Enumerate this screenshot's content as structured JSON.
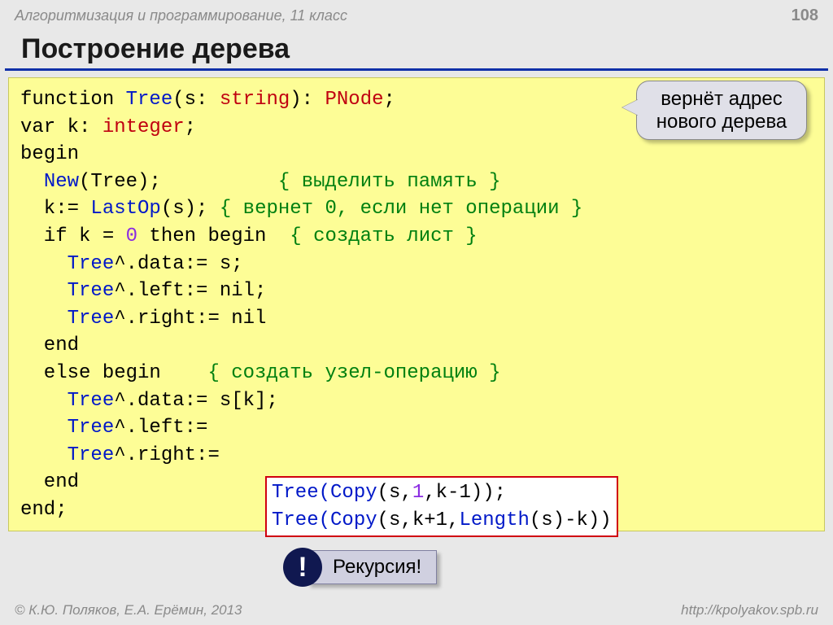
{
  "header": {
    "subject": "Алгоритмизация и программирование, 11 класс",
    "page": "108"
  },
  "title": "Построение дерева",
  "callout": "вернёт адрес нового дерева",
  "code": {
    "l1_function": "function",
    "l1_tree": " Tree",
    "l1_paren_s": "(s:",
    "l1_string": " string",
    "l1_paren_close": "):",
    "l1_pnode": " PNode",
    "l1_semi": ";",
    "l2": "var k:",
    "l2_integer": " integer",
    "l2_semi": ";",
    "l3": "begin",
    "l4_indent": "  ",
    "l4_new": "New",
    "l4_tree": "(Tree);",
    "l4_pad": "          ",
    "l4_comment": "{ выделить память }",
    "l5_indent": "  k:=",
    "l5_lastop": " LastOp",
    "l5_rest": "(s);",
    "l5_comment": " { вернет 0, если нет операции }",
    "l6_indent": "  if k =",
    "l6_zero": " 0",
    "l6_then": " then begin  ",
    "l6_comment": "{ создать лист }",
    "l7_indent": "    ",
    "l7_tree": "Tree",
    "l7_rest": "^.data:= s;",
    "l8_indent": "    ",
    "l8_tree": "Tree",
    "l8_rest": "^.left:= nil;",
    "l9_indent": "    ",
    "l9_tree": "Tree",
    "l9_rest": "^.right:= nil",
    "l10": "  end",
    "l11_else": "  else begin    ",
    "l11_comment": "{ создать узел-операцию }",
    "l12_indent": "    ",
    "l12_tree": "Tree",
    "l12_rest": "^.data:= s[k];",
    "l13_indent": "    ",
    "l13_tree": "Tree",
    "l13_rest": "^.left:=",
    "l14_indent": "    ",
    "l14_tree": "Tree",
    "l14_rest": "^.right:=",
    "l15": "  end",
    "l16": "end;"
  },
  "redbox": {
    "line1_tree": "Tree",
    "line1_copy": "(Copy",
    "line1_args": "(s,",
    "line1_one": "1",
    "line1_rest": ",k-1));",
    "line2_tree": "Tree",
    "line2_copy": "(Copy",
    "line2_args": "(s,k+1,",
    "line2_len": "Length",
    "line2_rest": "(s)-k))"
  },
  "recursion": {
    "bang": "!",
    "label": "Рекурсия!"
  },
  "footer": {
    "copyright": "© К.Ю. Поляков, Е.А. Ерёмин, 2013",
    "url": "http://kpolyakov.spb.ru"
  }
}
